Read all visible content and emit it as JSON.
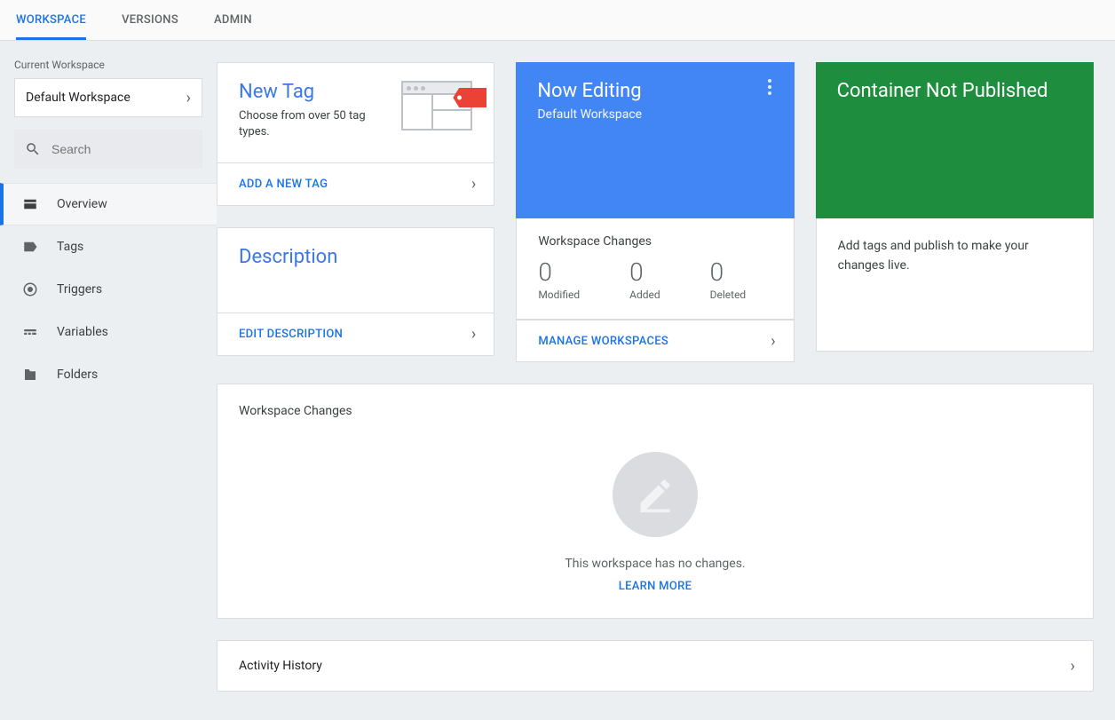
{
  "topnav": {
    "tabs": [
      "WORKSPACE",
      "VERSIONS",
      "ADMIN"
    ]
  },
  "sidebar": {
    "current_workspace_label": "Current Workspace",
    "workspace_name": "Default Workspace",
    "search_placeholder": "Search",
    "items": [
      {
        "label": "Overview"
      },
      {
        "label": "Tags"
      },
      {
        "label": "Triggers"
      },
      {
        "label": "Variables"
      },
      {
        "label": "Folders"
      }
    ]
  },
  "cards": {
    "new_tag": {
      "title": "New Tag",
      "subtitle": "Choose from over 50 tag types.",
      "action": "ADD A NEW TAG"
    },
    "description": {
      "title": "Description",
      "action": "EDIT DESCRIPTION"
    },
    "now_editing": {
      "title": "Now Editing",
      "workspace": "Default Workspace",
      "section_title": "Workspace Changes",
      "stats": {
        "modified": {
          "value": "0",
          "label": "Modified"
        },
        "added": {
          "value": "0",
          "label": "Added"
        },
        "deleted": {
          "value": "0",
          "label": "Deleted"
        }
      },
      "action": "MANAGE WORKSPACES"
    },
    "not_published": {
      "title": "Container Not Published",
      "body": "Add tags and publish to make your changes live."
    }
  },
  "workspace_changes_panel": {
    "title": "Workspace Changes",
    "empty_text": "This workspace has no changes.",
    "learn_more": "LEARN MORE"
  },
  "activity_history": {
    "title": "Activity History"
  }
}
